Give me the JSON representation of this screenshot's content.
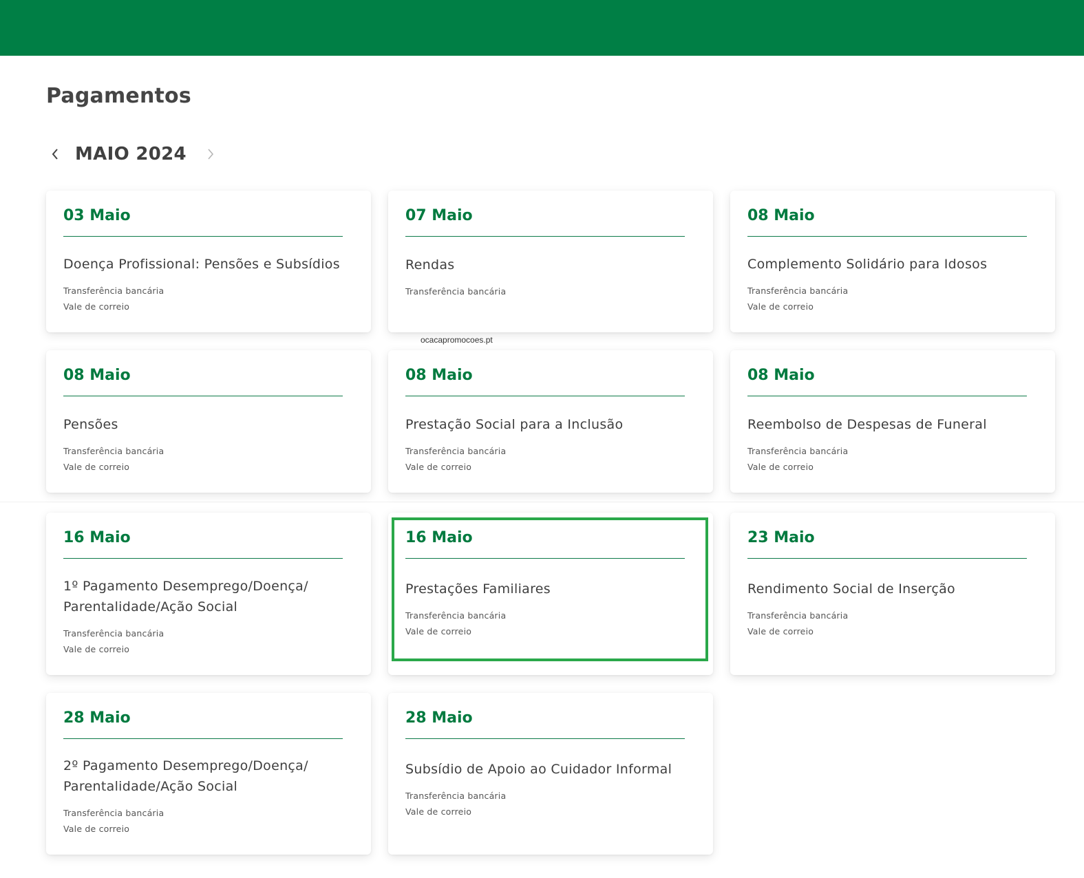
{
  "page": {
    "title": "Pagamentos",
    "month_label": "MAIO 2024",
    "prev_icon": "chevron-left-icon",
    "next_icon": "chevron-right-icon",
    "watermark": "ocacapromocoes.pt",
    "colors": {
      "header_green": "#007f45",
      "date_green": "#007a3f",
      "highlight_green": "#2aa84a"
    }
  },
  "cards": [
    {
      "date": "03 Maio",
      "title_lines": [
        "Doença Profissional: Pensões e Subsídios"
      ],
      "methods": [
        "Transferência bancária",
        "Vale de correio"
      ]
    },
    {
      "date": "07 Maio",
      "title_lines": [
        "Rendas"
      ],
      "methods": [
        "Transferência bancária"
      ]
    },
    {
      "date": "08 Maio",
      "title_lines": [
        "Complemento Solidário para Idosos"
      ],
      "methods": [
        "Transferência bancária",
        "Vale de correio"
      ]
    },
    {
      "date": "08 Maio",
      "title_lines": [
        "Pensões"
      ],
      "methods": [
        "Transferência bancária",
        "Vale de correio"
      ]
    },
    {
      "date": "08 Maio",
      "title_lines": [
        "Prestação Social para a Inclusão"
      ],
      "methods": [
        "Transferência bancária",
        "Vale de correio"
      ]
    },
    {
      "date": "08 Maio",
      "title_lines": [
        "Reembolso de Despesas de Funeral"
      ],
      "methods": [
        "Transferência bancária",
        "Vale de correio"
      ]
    },
    {
      "date": "16 Maio",
      "title_lines": [
        "1º Pagamento Desemprego/Doença/",
        "Parentalidade/Ação Social"
      ],
      "methods": [
        "Transferência bancária",
        "Vale de correio"
      ]
    },
    {
      "date": "16 Maio",
      "title_lines": [
        "Prestações Familiares"
      ],
      "methods": [
        "Transferência bancária",
        "Vale de correio"
      ]
    },
    {
      "date": "23 Maio",
      "title_lines": [
        "Rendimento Social de Inserção"
      ],
      "methods": [
        "Transferência bancária",
        "Vale de correio"
      ]
    },
    {
      "date": "28 Maio",
      "title_lines": [
        "2º Pagamento Desemprego/Doença/",
        "Parentalidade/Ação Social"
      ],
      "methods": [
        "Transferência bancária",
        "Vale de correio"
      ]
    },
    {
      "date": "28 Maio",
      "title_lines": [
        "Subsídio de Apoio ao Cuidador Informal"
      ],
      "methods": [
        "Transferência bancária",
        "Vale de correio"
      ]
    }
  ]
}
